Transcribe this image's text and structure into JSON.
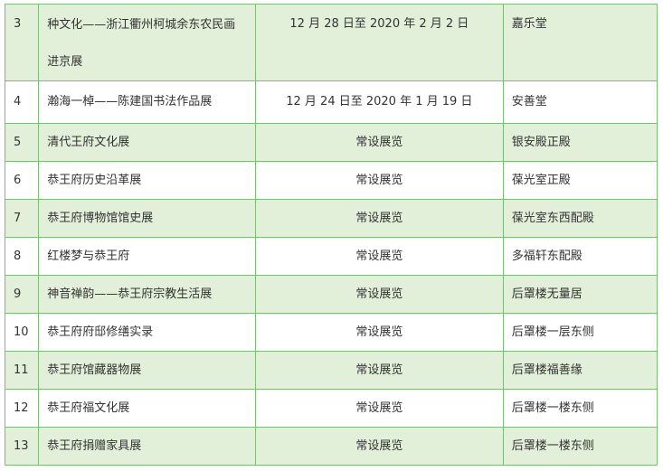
{
  "rows": [
    {
      "num": "3",
      "title": "种文化——浙江衢州柯城余东农民画进京展",
      "date": "12 月 28 日至 2020 年 2 月 2 日",
      "venue": "嘉乐堂"
    },
    {
      "num": "4",
      "title": "瀚海一棹——陈建国书法作品展",
      "date": "12 月 24 日至 2020 年 1 月 19 日",
      "venue": "安善堂"
    },
    {
      "num": "5",
      "title": "清代王府文化展",
      "date": "常设展览",
      "venue": "银安殿正殿"
    },
    {
      "num": "6",
      "title": "恭王府历史沿革展",
      "date": "常设展览",
      "venue": "葆光室正殿"
    },
    {
      "num": "7",
      "title": "恭王府博物馆馆史展",
      "date": "常设展览",
      "venue": "葆光室东西配殿"
    },
    {
      "num": "8",
      "title": "红楼梦与恭王府",
      "date": "常设展览",
      "venue": "多福轩东配殿"
    },
    {
      "num": "9",
      "title": "神音禅韵——恭王府宗教生活展",
      "date": "常设展览",
      "venue": "后罩楼无量居"
    },
    {
      "num": "10",
      "title": "恭王府府邸修缮实录",
      "date": "常设展览",
      "venue": "后罩楼一层东侧"
    },
    {
      "num": "11",
      "title": "恭王府馆藏器物展",
      "date": "常设展览",
      "venue": "后罩楼福善缘"
    },
    {
      "num": "12",
      "title": "恭王府福文化展",
      "date": "常设展览",
      "venue": "后罩楼一楼东侧"
    },
    {
      "num": "13",
      "title": "恭王府捐赠家具展",
      "date": "常设展览",
      "venue": "后罩楼一楼东侧"
    }
  ]
}
